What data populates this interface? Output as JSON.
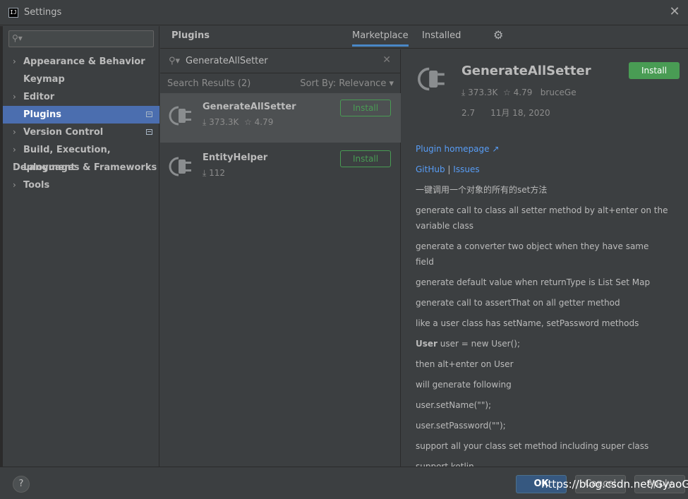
{
  "window": {
    "title": "Settings",
    "app_icon_text": "IJ"
  },
  "sidebar": {
    "search_placeholder": "",
    "items": [
      {
        "label": "Appearance & Behavior",
        "expandable": true
      },
      {
        "label": "Keymap",
        "expandable": false
      },
      {
        "label": "Editor",
        "expandable": true
      },
      {
        "label": "Plugins",
        "expandable": false,
        "selected": true
      },
      {
        "label": "Version Control",
        "expandable": true
      },
      {
        "label": "Build, Execution, Deployment",
        "expandable": true
      },
      {
        "label": "Languages & Frameworks",
        "expandable": true
      },
      {
        "label": "Tools",
        "expandable": true
      }
    ]
  },
  "header": {
    "title": "Plugins",
    "tabs": [
      {
        "label": "Marketplace",
        "active": true
      },
      {
        "label": "Installed",
        "active": false
      }
    ]
  },
  "search": {
    "query": "GenerateAllSetter"
  },
  "results": {
    "count_label": "Search Results (2)",
    "sort_label": "Sort By: Relevance",
    "plugins": [
      {
        "name": "GenerateAllSetter",
        "downloads": "373.3K",
        "rating": "4.79",
        "install_label": "Install"
      },
      {
        "name": "EntityHelper",
        "downloads": "112",
        "install_label": "Install"
      }
    ]
  },
  "detail": {
    "name": "GenerateAllSetter",
    "install_label": "Install",
    "downloads": "373.3K",
    "rating": "4.79",
    "vendor": "bruceGe",
    "version": "2.7",
    "date": "11月 18, 2020",
    "homepage_label": "Plugin homepage ↗",
    "github_label": "GitHub",
    "separator": "|",
    "issues_label": "Issues",
    "lines": [
      "一键调用一个对象的所有的set方法",
      "generate call to class all setter method by alt+enter on the variable class",
      "generate a converter two object when they have same field",
      "generate default value when returnType is List Set Map",
      "generate call to assertThat on all getter method",
      "like a user class has setName, setPassword methods"
    ],
    "code_bold": "User",
    "code_rest": " user = new User();",
    "lines2": [
      "then alt+enter on User",
      "will generate following",
      "user.setName(\"\");",
      "user.setPassword(\"\");",
      "support all your class set method including super class",
      "support kotlin"
    ]
  },
  "footer": {
    "help": "?",
    "ok": "OK",
    "cancel": "Cancel",
    "apply": "Apply",
    "watermark": "https://blog.csdn.net/GyaoG"
  }
}
